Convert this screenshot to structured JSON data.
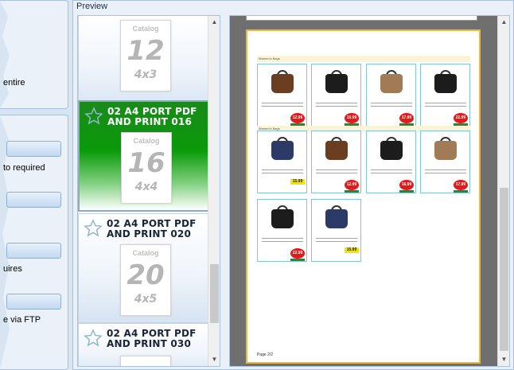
{
  "left_panel": {
    "texts": [
      "entire",
      "to required",
      "uires",
      "e via FTP"
    ]
  },
  "preview": {
    "title": "Preview",
    "templates": [
      {
        "name": "",
        "thumb_catalog": "Catalog",
        "thumb_number": "12",
        "thumb_grid": "4x3",
        "selected": false
      },
      {
        "name": "02 A4 PORT PDF AND PRINT 016",
        "thumb_catalog": "Catalog",
        "thumb_number": "16",
        "thumb_grid": "4x4",
        "selected": true
      },
      {
        "name": "02 A4 PORT PDF AND PRINT 020",
        "thumb_catalog": "Catalog",
        "thumb_number": "20",
        "thumb_grid": "4x5",
        "selected": false
      },
      {
        "name": "02 A4 PORT PDF AND PRINT 030",
        "thumb_catalog": "",
        "thumb_number": "",
        "thumb_grid": "",
        "selected": false
      }
    ],
    "page": {
      "sections": [
        "Women's Bags",
        "Women's Bags"
      ],
      "prices": [
        "12.99",
        "15.99",
        "17.99",
        "22.99",
        "15.99",
        "12.99",
        "16.99",
        "17.99",
        "22.99",
        "15.99"
      ],
      "footer": "Page 2/2"
    }
  },
  "colors": {
    "selected_green": "#0a9a0a",
    "price_red": "#e21a1a",
    "page_border": "#f0b838"
  }
}
